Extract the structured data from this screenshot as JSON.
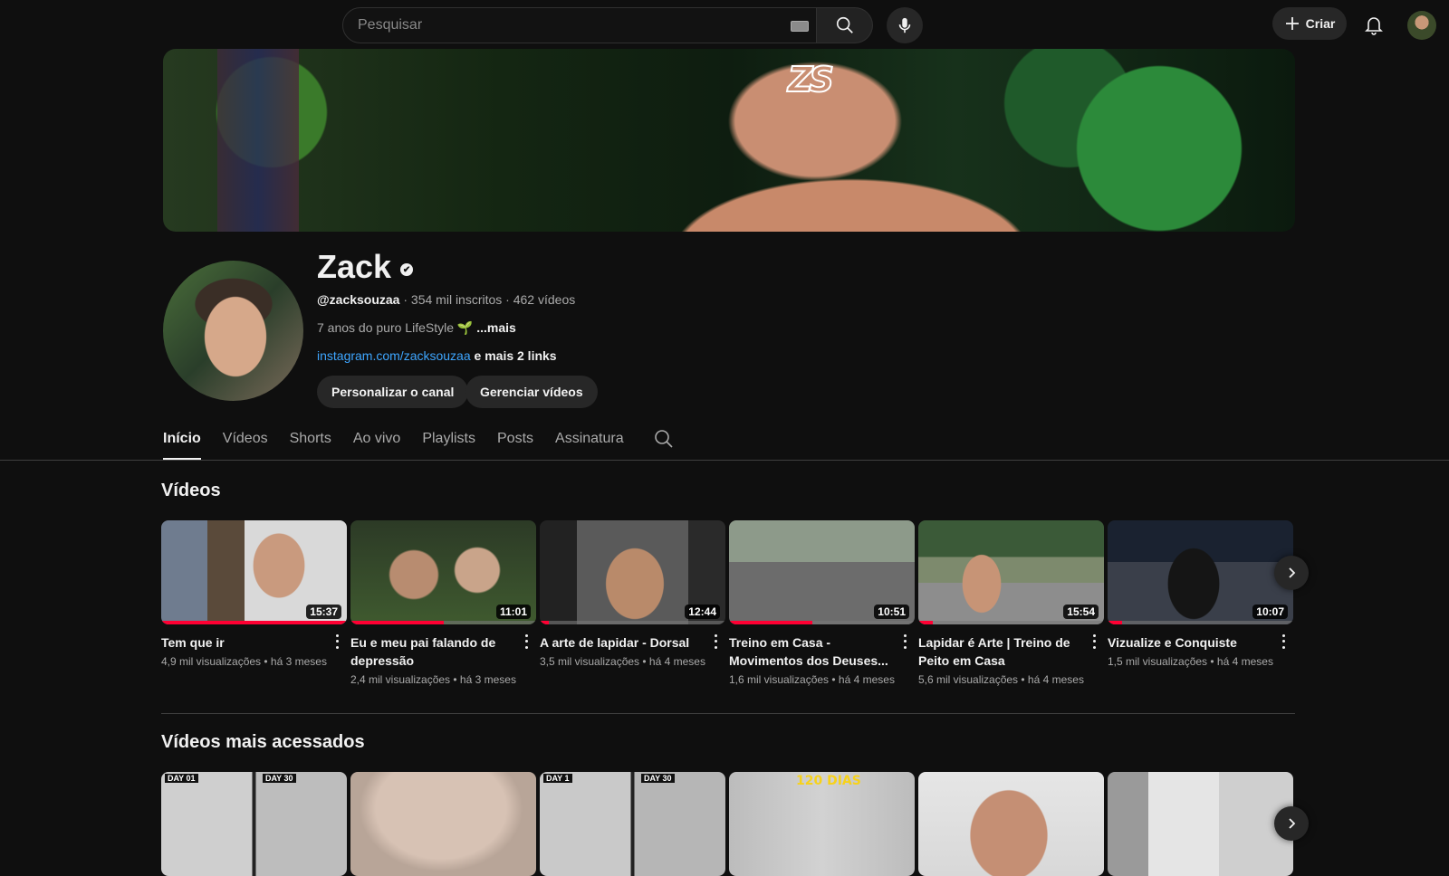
{
  "search": {
    "placeholder": "Pesquisar"
  },
  "header": {
    "create_label": "Criar"
  },
  "channel": {
    "name": "Zack",
    "handle": "@zacksouzaa",
    "stats": " · 354 mil inscritos · 462 vídeos",
    "description": "7 anos do puro LifeStyle 🌱 ",
    "more_label": "...mais",
    "link": "instagram.com/zacksouzaa",
    "more_links": " e mais 2 links",
    "buttons": {
      "customize": "Personalizar o canal",
      "manage": "Gerenciar vídeos"
    }
  },
  "tabs": [
    "Início",
    "Vídeos",
    "Shorts",
    "Ao vivo",
    "Playlists",
    "Posts",
    "Assinatura"
  ],
  "sections": {
    "videos_title": "Vídeos",
    "popular_title": "Vídeos mais acessados"
  },
  "videos": [
    {
      "title": "Tem que ir",
      "meta": "4,9 mil visualizações • há 3 meses",
      "duration": "15:37",
      "watched": 1.0
    },
    {
      "title": "Eu e meu pai falando de depressão",
      "meta": "2,4 mil visualizações • há 3 meses",
      "duration": "11:01",
      "watched": 0.5
    },
    {
      "title": "A arte de lapidar - Dorsal",
      "meta": "3,5 mil visualizações • há 4 meses",
      "duration": "12:44",
      "watched": 0.05
    },
    {
      "title": "Treino em Casa - Movimentos dos Deuses...",
      "meta": "1,6 mil visualizações • há 4 meses",
      "duration": "10:51",
      "watched": 0.45
    },
    {
      "title": "Lapidar é Arte | Treino de Peito em Casa",
      "meta": "5,6 mil visualizações • há 4 meses",
      "duration": "15:54",
      "watched": 0.08
    },
    {
      "title": "Vizualize e Conquiste",
      "meta": "1,5 mil visualizações • há 4 meses",
      "duration": "10:07",
      "watched": 0.08
    }
  ],
  "popular_labels": {
    "day01": "DAY 01",
    "day30": "DAY 30",
    "day1": "DAY 1",
    "day30b": "DAY 30",
    "dias120": "120 DIAS"
  },
  "colors": {
    "accent": "#ff0033",
    "link": "#3ea6ff",
    "background": "#0f0f0f"
  }
}
